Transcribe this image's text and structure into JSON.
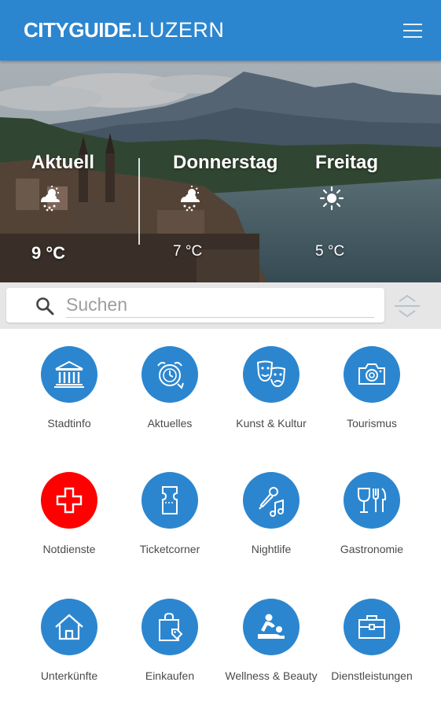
{
  "header": {
    "brand_city": "CITYGUIDE",
    "brand_dot": ".",
    "brand_place": "LUZERN",
    "colors": {
      "bar": "#2c86cf"
    }
  },
  "weather": [
    {
      "day": "Aktuell",
      "temp": "9 °C",
      "icon": "snow-cloud-icon"
    },
    {
      "day": "Donnerstag",
      "temp": "7 °C",
      "icon": "snow-cloud-icon"
    },
    {
      "day": "Freitag",
      "temp": "5 °C",
      "icon": "sun-icon"
    }
  ],
  "search": {
    "placeholder": "Suchen",
    "value": ""
  },
  "tiles": [
    {
      "label": "Stadtinfo",
      "icon": "city-hall-icon",
      "color": "#2c86cf"
    },
    {
      "label": "Aktuelles",
      "icon": "alarm-clock-icon",
      "color": "#2c86cf"
    },
    {
      "label": "Kunst & Kultur",
      "icon": "theater-masks-icon",
      "color": "#2c86cf"
    },
    {
      "label": "Tourismus",
      "icon": "camera-icon",
      "color": "#2c86cf"
    },
    {
      "label": "Notdienste",
      "icon": "medical-cross-icon",
      "color": "#ff0000"
    },
    {
      "label": "Ticketcorner",
      "icon": "ticket-icon",
      "color": "#2c86cf"
    },
    {
      "label": "Nightlife",
      "icon": "microphone-music-icon",
      "color": "#2c86cf"
    },
    {
      "label": "Gastronomie",
      "icon": "wine-cutlery-icon",
      "color": "#2c86cf"
    },
    {
      "label": "Unterkünfte",
      "icon": "house-icon",
      "color": "#2c86cf"
    },
    {
      "label": "Einkaufen",
      "icon": "shopping-bag-icon",
      "color": "#2c86cf"
    },
    {
      "label": "Wellness & Beauty",
      "icon": "massage-icon",
      "color": "#2c86cf"
    },
    {
      "label": "Dienstleistungen",
      "icon": "briefcase-icon",
      "color": "#2c86cf"
    }
  ]
}
